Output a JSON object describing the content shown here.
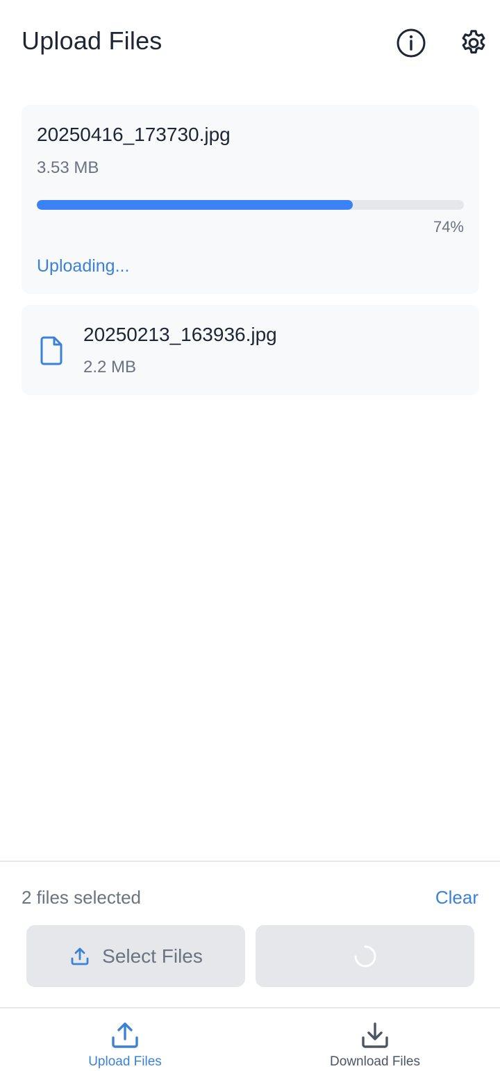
{
  "header": {
    "title": "Upload Files",
    "info_icon": "info-icon",
    "settings_icon": "gear-icon"
  },
  "files": [
    {
      "name": "20250416_173730.jpg",
      "size": "3.53 MB",
      "progress_percent": 74,
      "progress_label": "74%",
      "status": "Uploading..."
    },
    {
      "name": "20250213_163936.jpg",
      "size": "2.2 MB",
      "icon": "file-icon"
    }
  ],
  "actions": {
    "selected_count": "2 files selected",
    "clear_label": "Clear",
    "select_files_label": "Select Files",
    "select_files_icon": "upload-icon",
    "upload_button_state": "loading-spinner"
  },
  "bottom_nav": {
    "items": [
      {
        "label": "Upload Files",
        "icon": "upload-icon",
        "active": true
      },
      {
        "label": "Download Files",
        "icon": "download-icon",
        "active": false
      }
    ]
  },
  "colors": {
    "accent": "#3b82d6",
    "progress_fill": "#3b82f6",
    "card_bg": "#f8f9fb",
    "button_bg": "#e5e7eb"
  }
}
